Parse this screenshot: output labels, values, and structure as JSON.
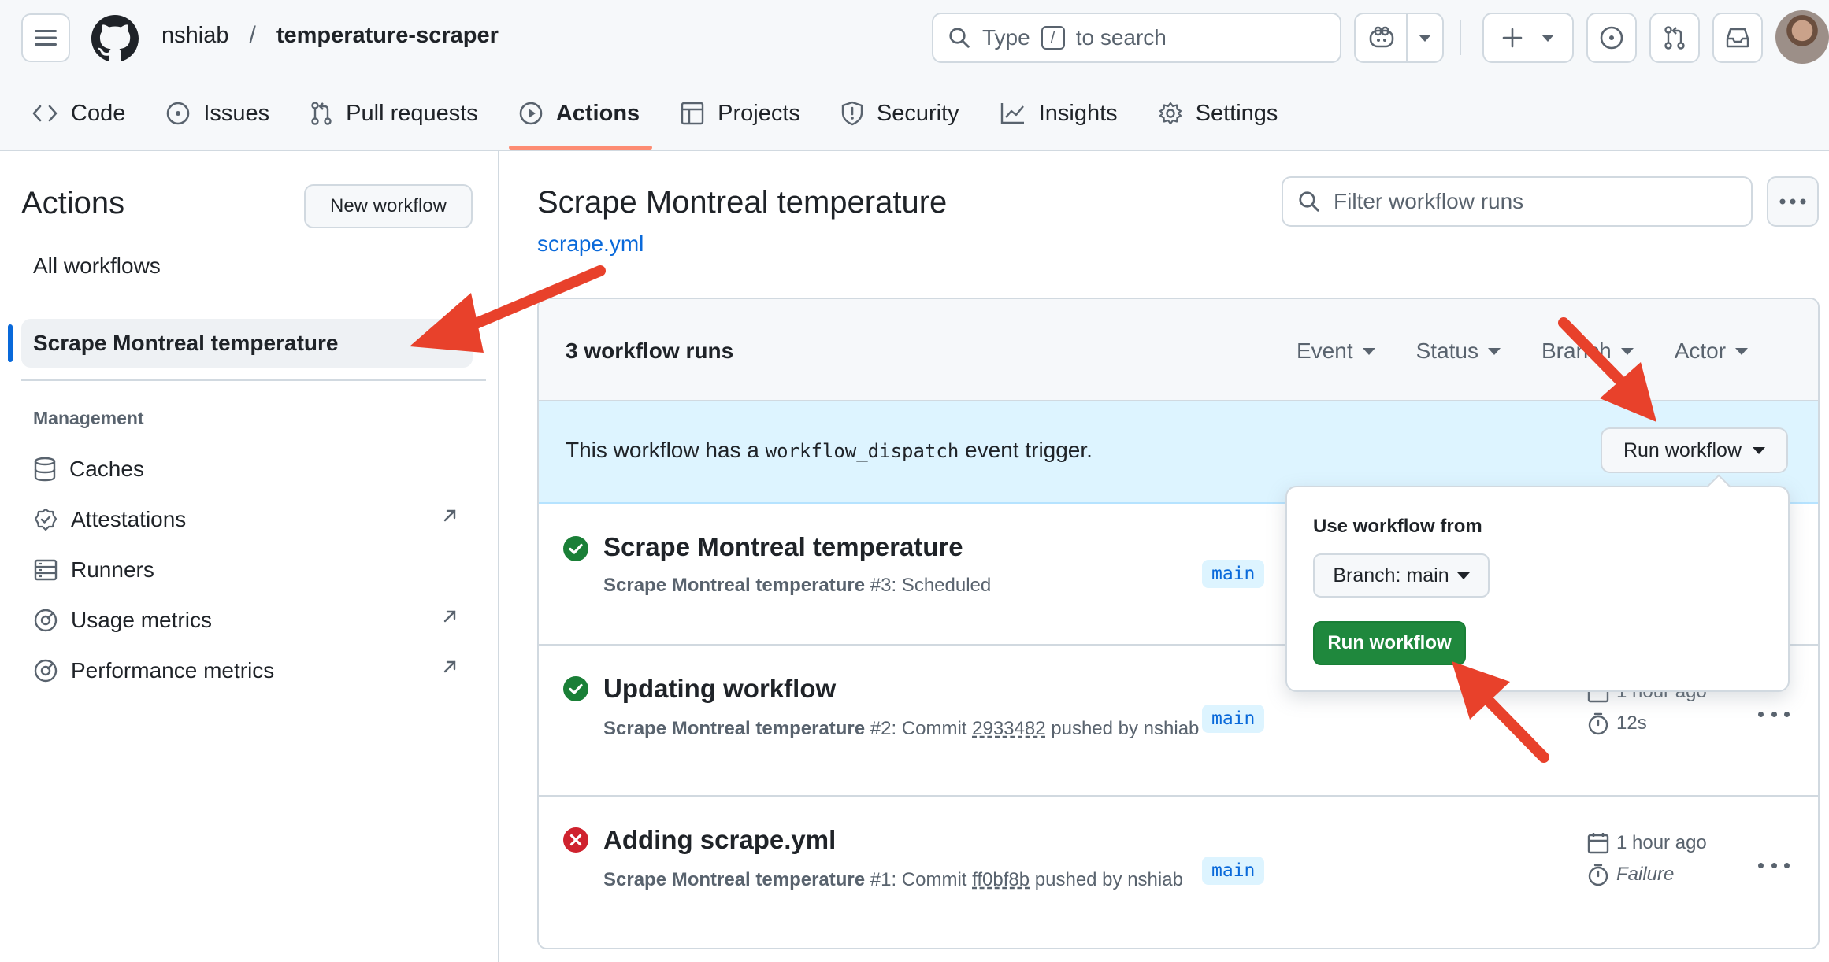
{
  "header": {
    "owner": "nshiab",
    "separator": "/",
    "repo": "temperature-scraper",
    "search_prefix": "Type",
    "search_key": "/",
    "search_suffix": "to search"
  },
  "nav_tabs": [
    {
      "label": "Code",
      "icon": "code-icon"
    },
    {
      "label": "Issues",
      "icon": "issue-icon"
    },
    {
      "label": "Pull requests",
      "icon": "pull-request-icon"
    },
    {
      "label": "Actions",
      "icon": "play-icon",
      "active": true
    },
    {
      "label": "Projects",
      "icon": "table-icon"
    },
    {
      "label": "Security",
      "icon": "shield-icon"
    },
    {
      "label": "Insights",
      "icon": "graph-icon"
    },
    {
      "label": "Settings",
      "icon": "gear-icon"
    }
  ],
  "sidebar": {
    "title": "Actions",
    "new_workflow": "New workflow",
    "all_workflows": "All workflows",
    "active_workflow": "Scrape Montreal temperature",
    "management_heading": "Management",
    "management_items": [
      {
        "label": "Caches",
        "icon": "database-icon",
        "external": false
      },
      {
        "label": "Attestations",
        "icon": "verified-icon",
        "external": true
      },
      {
        "label": "Runners",
        "icon": "server-icon",
        "external": false
      },
      {
        "label": "Usage metrics",
        "icon": "meter-icon",
        "external": true
      },
      {
        "label": "Performance metrics",
        "icon": "meter-icon",
        "external": true
      }
    ]
  },
  "main": {
    "title": "Scrape Montreal temperature",
    "file": "scrape.yml",
    "filter_placeholder": "Filter workflow runs",
    "run_count": "3 workflow runs",
    "filters": [
      "Event",
      "Status",
      "Branch",
      "Actor"
    ],
    "dispatch_before": "This workflow has a ",
    "dispatch_code": "workflow_dispatch",
    "dispatch_after": " event trigger.",
    "run_workflow_label": "Run workflow"
  },
  "runs": [
    {
      "title": "Scrape Montreal temperature",
      "workflow": "Scrape Montreal temperature",
      "number": " #3: Scheduled",
      "commit": "",
      "by": "",
      "status": "success",
      "branch": "main",
      "time": "",
      "duration": ""
    },
    {
      "title": "Updating workflow",
      "workflow": "Scrape Montreal temperature",
      "number": " #2: Commit ",
      "commit": "2933482",
      "by": " pushed by nshiab",
      "status": "success",
      "branch": "main",
      "time": "1 hour ago",
      "duration": "12s"
    },
    {
      "title": "Adding scrape.yml",
      "workflow": "Scrape Montreal temperature",
      "number": " #1: Commit ",
      "commit": "ff0bf8b",
      "by": " pushed by nshiab",
      "status": "failure",
      "branch": "main",
      "time": "1 hour ago",
      "duration": "Failure"
    }
  ],
  "popover": {
    "label": "Use workflow from",
    "branch_select": "Branch: main",
    "submit": "Run workflow"
  },
  "colors": {
    "accent": "#0969da",
    "success": "#1a7f37",
    "failure": "#cf222e",
    "annotation_arrow": "#e8412b",
    "tab_underline": "#fd8c73"
  }
}
